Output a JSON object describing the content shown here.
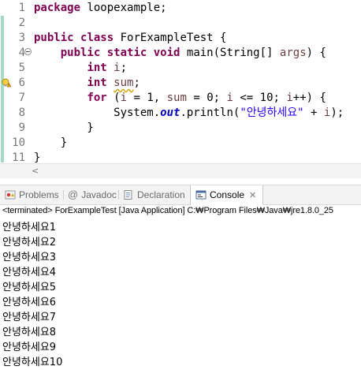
{
  "editor": {
    "lines": [
      {
        "num": "1",
        "tokens": [
          {
            "t": "package",
            "c": "kw"
          },
          {
            "t": " loopexample;",
            "c": ""
          }
        ]
      },
      {
        "num": "2",
        "tokens": []
      },
      {
        "num": "3",
        "tokens": [
          {
            "t": "public",
            "c": "kw"
          },
          {
            "t": " ",
            "c": ""
          },
          {
            "t": "class",
            "c": "kw"
          },
          {
            "t": " ForExampleTest {",
            "c": ""
          }
        ]
      },
      {
        "num": "4",
        "fold": true,
        "tokens": [
          {
            "t": "    ",
            "c": ""
          },
          {
            "t": "public",
            "c": "kw"
          },
          {
            "t": " ",
            "c": ""
          },
          {
            "t": "static",
            "c": "kw"
          },
          {
            "t": " ",
            "c": ""
          },
          {
            "t": "void",
            "c": "kw"
          },
          {
            "t": " main(String[] ",
            "c": ""
          },
          {
            "t": "args",
            "c": "var"
          },
          {
            "t": ") {",
            "c": ""
          }
        ]
      },
      {
        "num": "5",
        "tokens": [
          {
            "t": "        ",
            "c": ""
          },
          {
            "t": "int",
            "c": "kw"
          },
          {
            "t": " ",
            "c": ""
          },
          {
            "t": "i",
            "c": "var"
          },
          {
            "t": ";",
            "c": ""
          }
        ]
      },
      {
        "num": "6",
        "warning": true,
        "tokens": [
          {
            "t": "        ",
            "c": ""
          },
          {
            "t": "int",
            "c": "kw"
          },
          {
            "t": " ",
            "c": ""
          },
          {
            "t": "sum",
            "c": "var warn-underline"
          },
          {
            "t": ";",
            "c": ""
          }
        ]
      },
      {
        "num": "7",
        "tokens": [
          {
            "t": "        ",
            "c": ""
          },
          {
            "t": "for",
            "c": "kw"
          },
          {
            "t": " (",
            "c": ""
          },
          {
            "t": "i",
            "c": "var"
          },
          {
            "t": " = 1, ",
            "c": ""
          },
          {
            "t": "sum",
            "c": "var"
          },
          {
            "t": " = 0; ",
            "c": ""
          },
          {
            "t": "i",
            "c": "var"
          },
          {
            "t": " <= 10; ",
            "c": ""
          },
          {
            "t": "i",
            "c": "var"
          },
          {
            "t": "++) {",
            "c": ""
          }
        ]
      },
      {
        "num": "8",
        "tokens": [
          {
            "t": "            System.",
            "c": ""
          },
          {
            "t": "out",
            "c": "field"
          },
          {
            "t": ".println(",
            "c": ""
          },
          {
            "t": "\"안녕하세요\"",
            "c": "str"
          },
          {
            "t": " + ",
            "c": ""
          },
          {
            "t": "i",
            "c": "var"
          },
          {
            "t": ");",
            "c": ""
          }
        ]
      },
      {
        "num": "9",
        "tokens": [
          {
            "t": "        }",
            "c": ""
          }
        ]
      },
      {
        "num": "10",
        "tokens": [
          {
            "t": "    }",
            "c": ""
          }
        ]
      },
      {
        "num": "11",
        "tokens": [
          {
            "t": "}",
            "c": ""
          }
        ]
      }
    ],
    "scroll_left_glyph": "<"
  },
  "tabs": {
    "problems": "Problems",
    "javadoc": "Javadoc",
    "declaration": "Declaration",
    "console": "Console",
    "close_glyph": "✕"
  },
  "console": {
    "status": "<terminated> ForExampleTest [Java Application] C:₩Program Files₩Java₩jre1.8.0_25",
    "output": [
      "안녕하세요1",
      "안녕하세요2",
      "안녕하세요3",
      "안녕하세요4",
      "안녕하세요5",
      "안녕하세요6",
      "안녕하세요7",
      "안녕하세요8",
      "안녕하세요9",
      "안녕하세요10"
    ]
  },
  "colors": {
    "keyword": "#7f0055",
    "local_variable": "#6a3e3e",
    "string": "#2a00ff",
    "static_field": "#0000c0",
    "change_bar": "#a4d9c8"
  }
}
